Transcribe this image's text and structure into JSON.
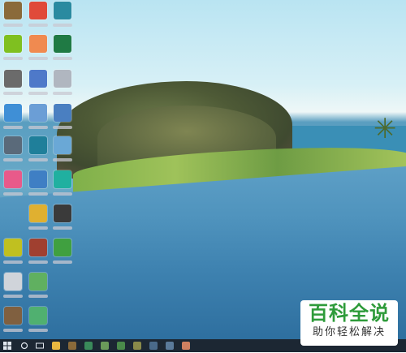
{
  "watermark": {
    "title": "百科全说",
    "subtitle": "助你轻松解决"
  },
  "colors": {
    "taskbar": "#1c2733",
    "watermark_green": "#2e9b3a",
    "sky": "#d7f0f6",
    "water": "#3e82b0"
  },
  "desktop": {
    "icons": [
      {
        "name": "desktop-icon-1",
        "icon": "app-icon",
        "color": "#8a6a3a"
      },
      {
        "name": "desktop-icon-2",
        "icon": "pdf-icon",
        "color": "#e04a3a"
      },
      {
        "name": "desktop-icon-3",
        "icon": "browser-icon",
        "color": "#2a8aa0"
      },
      {
        "name": "desktop-icon-4",
        "icon": "green-4-icon",
        "color": "#7fc020"
      },
      {
        "name": "desktop-icon-5",
        "icon": "app-icon",
        "color": "#f08a50"
      },
      {
        "name": "desktop-icon-excel",
        "icon": "excel-icon",
        "color": "#1f7a44"
      },
      {
        "name": "desktop-icon-7",
        "icon": "app-icon",
        "color": "#6b6b6b"
      },
      {
        "name": "desktop-icon-8",
        "icon": "app-icon",
        "color": "#4e79c9"
      },
      {
        "name": "desktop-icon-9",
        "icon": "app-icon",
        "color": "#b0b6c0"
      },
      {
        "name": "desktop-icon-10",
        "icon": "app-icon",
        "color": "#3f8fd6"
      },
      {
        "name": "desktop-icon-11",
        "icon": "app-icon",
        "color": "#6b9ed6"
      },
      {
        "name": "desktop-icon-12",
        "icon": "app-icon",
        "color": "#4a7fc1"
      },
      {
        "name": "desktop-icon-13",
        "icon": "app-icon",
        "color": "#5a6a7a"
      },
      {
        "name": "desktop-icon-14",
        "icon": "app-icon",
        "color": "#1f7f9a"
      },
      {
        "name": "desktop-icon-15",
        "icon": "app-icon",
        "color": "#6aa8d6"
      },
      {
        "name": "desktop-icon-16",
        "icon": "app-icon",
        "color": "#e85a8a"
      },
      {
        "name": "desktop-icon-17",
        "icon": "app-icon",
        "color": "#3f7fc4"
      },
      {
        "name": "desktop-icon-18",
        "icon": "app-icon",
        "color": "#20b0a0"
      },
      {
        "name": "desktop-icon-19",
        "icon": "app-icon",
        "color": "#e0b030"
      },
      {
        "name": "desktop-icon-20",
        "icon": "app-icon",
        "color": "#3a3a3a"
      },
      {
        "name": "desktop-icon-21",
        "icon": "app-icon",
        "color": "#c0c020"
      },
      {
        "name": "desktop-icon-22",
        "icon": "app-icon",
        "color": "#a04030"
      },
      {
        "name": "desktop-icon-23",
        "icon": "app-icon",
        "color": "#40a040"
      },
      {
        "name": "desktop-icon-24",
        "icon": "app-icon",
        "color": "#d0d4da"
      },
      {
        "name": "desktop-icon-25",
        "icon": "app-icon",
        "color": "#60b060"
      },
      {
        "name": "desktop-icon-26",
        "icon": "app-icon",
        "color": "#806040"
      },
      {
        "name": "desktop-icon-27",
        "icon": "app-icon",
        "color": "#50b070"
      }
    ]
  },
  "taskbar": {
    "start_icon": "windows-icon",
    "search_icon": "search-icon",
    "taskview_icon": "task-view-icon",
    "apps": [
      {
        "name": "taskbar-file-explorer",
        "icon": "folder-icon",
        "color": "#e8b840"
      },
      {
        "name": "taskbar-app-2",
        "icon": "app-icon",
        "color": "#8a6a3a"
      },
      {
        "name": "taskbar-app-3",
        "icon": "app-icon",
        "color": "#3a8a5a"
      },
      {
        "name": "taskbar-app-4",
        "icon": "app-icon",
        "color": "#6a9a5a"
      },
      {
        "name": "taskbar-app-5",
        "icon": "app-icon",
        "color": "#4a8a4a"
      },
      {
        "name": "taskbar-app-6",
        "icon": "app-icon",
        "color": "#8a8a4a"
      },
      {
        "name": "taskbar-app-7",
        "icon": "app-icon",
        "color": "#4a6a8a"
      },
      {
        "name": "taskbar-app-8",
        "icon": "app-icon",
        "color": "#5a7a9a"
      },
      {
        "name": "taskbar-app-9",
        "icon": "app-icon",
        "color": "#d08060"
      }
    ]
  }
}
